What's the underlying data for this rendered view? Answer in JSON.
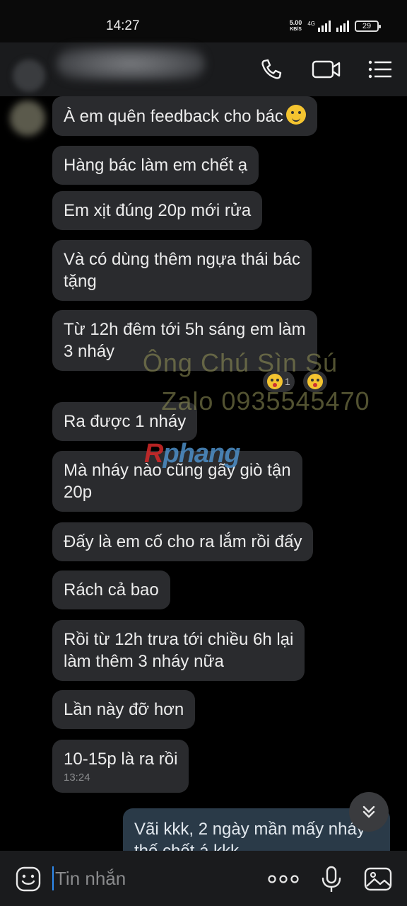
{
  "status_bar": {
    "time": "14:27",
    "net_speed_value": "5.00",
    "net_speed_unit": "KB/S",
    "network_type": "4G",
    "battery": "29"
  },
  "header": {
    "icons": [
      "phone-icon",
      "video-call-icon",
      "menu-icon"
    ]
  },
  "messages": [
    {
      "text": "À em quên feedback cho bác",
      "emoji": "smiling-tear-emoji"
    },
    {
      "text": "Hàng bác làm em chết ạ"
    },
    {
      "text": "Em xịt đúng 20p mới rửa"
    },
    {
      "line1": "Và có dùng thêm ngựa thái bác",
      "line2": "tặng"
    },
    {
      "line1": "Từ 12h đêm tới 5h sáng em làm",
      "line2": "3 nháy"
    },
    {
      "text": "Ra được 1 nháy"
    },
    {
      "line1": "Mà nháy nào cũng gãy giò tận",
      "line2": "20p"
    },
    {
      "text": "Đấy là em cố cho ra lắm rồi đấy"
    },
    {
      "text": "Rách cả bao"
    },
    {
      "line1": "Rồi từ 12h trưa tới chiều 6h lại",
      "line2": "làm thêm 3 nháy nữa"
    },
    {
      "text": "Lần này đỡ hơn"
    },
    {
      "text": "10-15p là ra rồi",
      "time": "13:24"
    }
  ],
  "reactions": [
    {
      "emoji": "tongue-wink-emoji",
      "count": "1"
    },
    {
      "emoji": "tongue-wink-emoji"
    }
  ],
  "outgoing": {
    "line1": "Vãi kkk, 2 ngày mần mấy nháy",
    "line2": "thế chết á kkk"
  },
  "watermark": {
    "line1": "Ông Chú Sìn Sú",
    "line2": "Zalo 0935545470",
    "logo_first": "R",
    "logo_rest": "phang"
  },
  "input_bar": {
    "placeholder": "Tin nhắn",
    "icons": [
      "sticker-icon",
      "more-icon",
      "microphone-icon",
      "image-icon"
    ]
  }
}
